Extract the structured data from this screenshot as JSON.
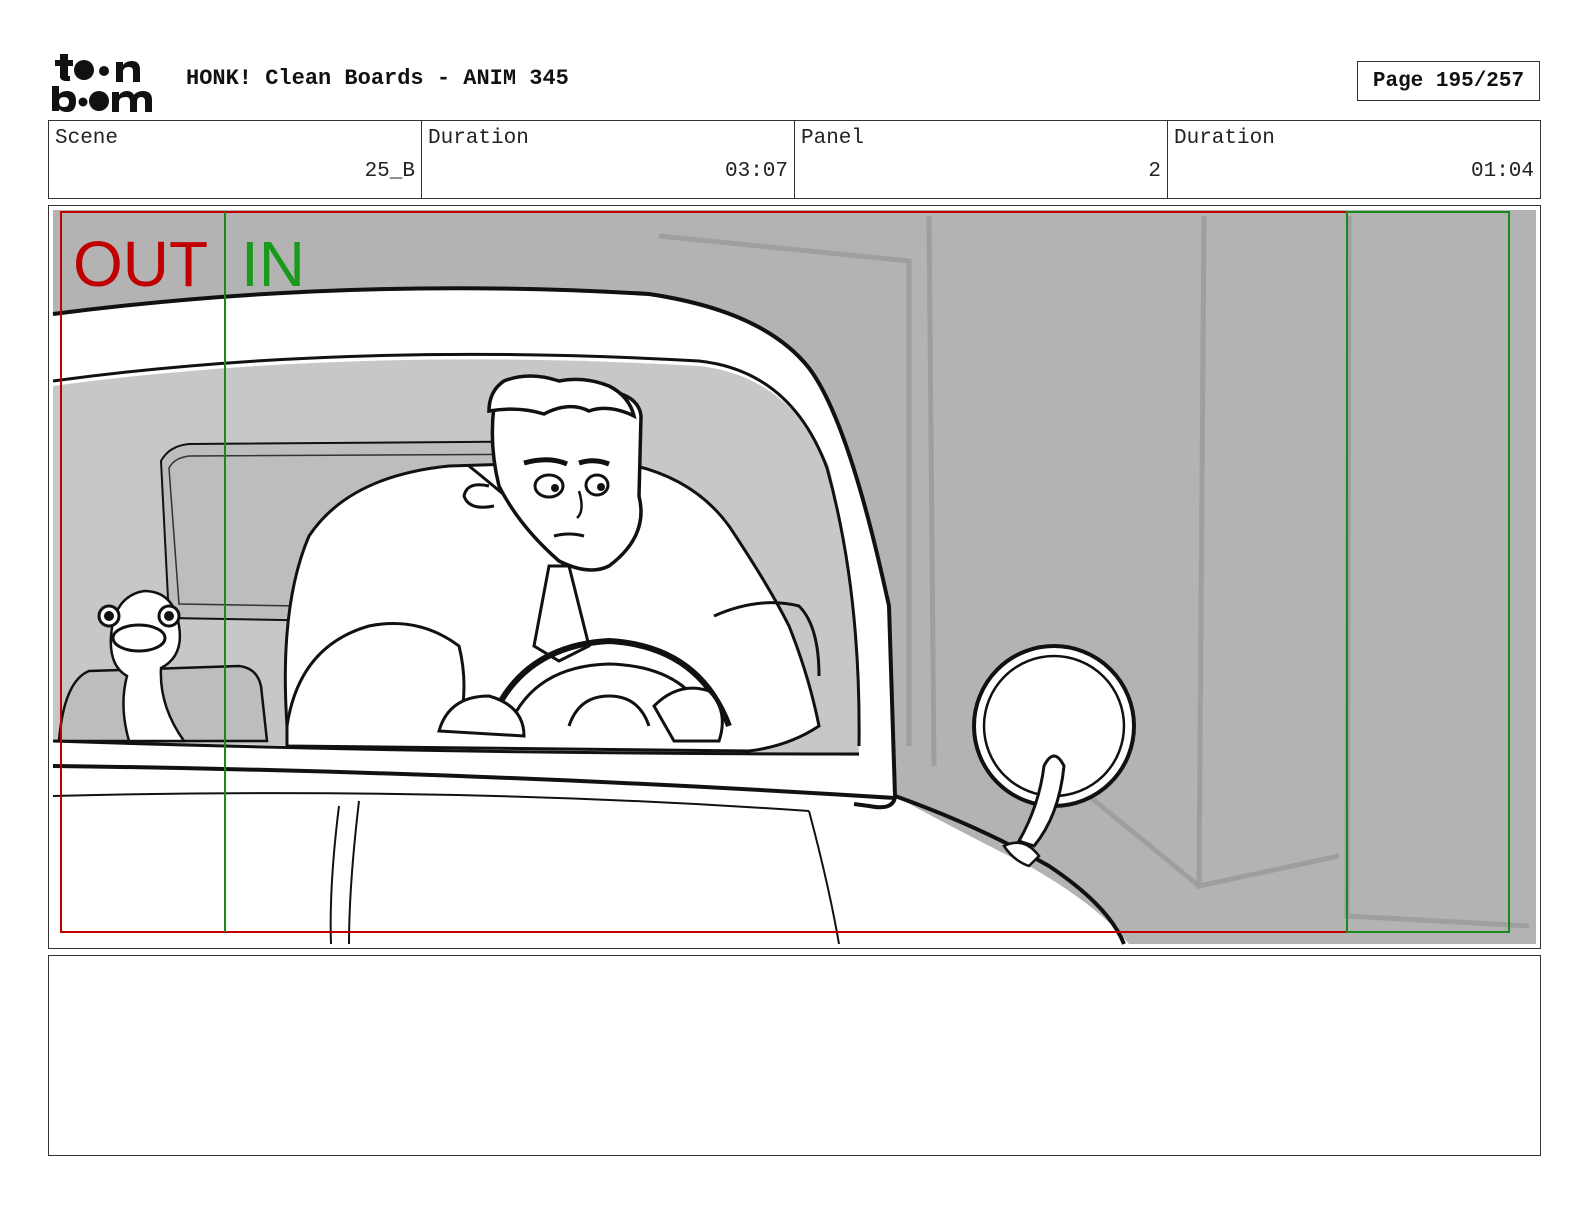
{
  "header": {
    "logo_text": "toonboom",
    "title": "HONK! Clean Boards - ANIM 345",
    "page_label": "Page 195/257"
  },
  "info": {
    "scene_label": "Scene",
    "scene_value": "25_B",
    "duration_label": "Duration",
    "duration_value": "03:07",
    "panel_label": "Panel",
    "panel_value": "2",
    "panel_duration_label": "Duration",
    "panel_duration_value": "01:04"
  },
  "panel": {
    "out_label": "OUT",
    "in_label": "IN",
    "colors": {
      "out_frame": "#c00000",
      "in_frame": "#1a8a1a",
      "background": "#b4b4b4"
    }
  },
  "notes": {
    "text": ""
  }
}
